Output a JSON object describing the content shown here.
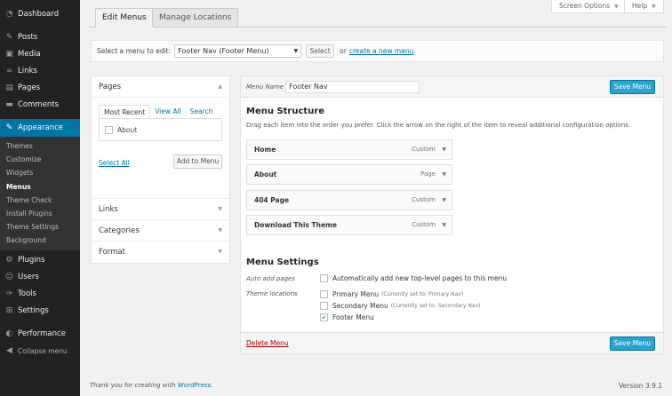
{
  "sidebar": {
    "items": [
      {
        "label": "Dashboard",
        "icon": "dashboard-icon",
        "glyph": "◔"
      },
      {
        "label": "Posts",
        "icon": "pin-icon",
        "glyph": "✎"
      },
      {
        "label": "Media",
        "icon": "media-icon",
        "glyph": "▣"
      },
      {
        "label": "Links",
        "icon": "link-icon",
        "glyph": "∞"
      },
      {
        "label": "Pages",
        "icon": "page-icon",
        "glyph": "▤"
      },
      {
        "label": "Comments",
        "icon": "comment-icon",
        "glyph": "▬"
      },
      {
        "label": "Appearance",
        "icon": "brush-icon",
        "glyph": "✎"
      },
      {
        "label": "Plugins",
        "icon": "plugin-icon",
        "glyph": "⚙"
      },
      {
        "label": "Users",
        "icon": "users-icon",
        "glyph": "☺"
      },
      {
        "label": "Tools",
        "icon": "wrench-icon",
        "glyph": "✑"
      },
      {
        "label": "Settings",
        "icon": "settings-icon",
        "glyph": "⊞"
      },
      {
        "label": "Performance",
        "icon": "performance-icon",
        "glyph": "◐"
      },
      {
        "label": "Collapse menu",
        "icon": "collapse-icon",
        "glyph": "◀"
      }
    ],
    "submenu": [
      "Themes",
      "Customize",
      "Widgets",
      "Menus",
      "Theme Check",
      "Install Plugins",
      "Theme Settings",
      "Background"
    ]
  },
  "tabs": {
    "edit_menus": "Edit Menus",
    "manage_locations": "Manage Locations"
  },
  "top_buttons": {
    "screen_options": "Screen Options",
    "help": "Help",
    "caret": "▼"
  },
  "select_bar": {
    "label": "Select a menu to edit:",
    "selected": "Footer Nav (Footer Menu)",
    "select_button": "Select",
    "or_text": "or",
    "create_link": "create a new menu",
    "period": "."
  },
  "left_panel": {
    "pages_title": "Pages",
    "tabs": [
      "Most Recent",
      "View All",
      "Search"
    ],
    "page_item": "About",
    "select_all": "Select All",
    "add_to_menu": "Add to Menu",
    "sections": [
      "Links",
      "Categories",
      "Format"
    ]
  },
  "menu_panel": {
    "name_label": "Menu Name",
    "name_value": "Footer Nav",
    "save_button": "Save Menu",
    "structure_title": "Menu Structure",
    "structure_hint": "Drag each item into the order you prefer. Click the arrow on the right of the item to reveal additional configuration options.",
    "items": [
      {
        "title": "Home",
        "type": "Custom"
      },
      {
        "title": "About",
        "type": "Page"
      },
      {
        "title": "404 Page",
        "type": "Custom"
      },
      {
        "title": "Download This Theme",
        "type": "Custom"
      }
    ],
    "settings_title": "Menu Settings",
    "auto_add_label": "Auto add pages",
    "auto_add_option": "Automatically add new top-level pages to this menu",
    "locations_label": "Theme locations",
    "locations": [
      {
        "name": "Primary Menu",
        "note": "(Currently set to: Primary Nav)",
        "checked": false
      },
      {
        "name": "Secondary Menu",
        "note": "(Currently set to: Secondary Nav)",
        "checked": false
      },
      {
        "name": "Footer Menu",
        "note": "",
        "checked": true
      }
    ],
    "delete_link": "Delete Menu"
  },
  "footer": {
    "thanks": "Thank you for creating with",
    "wp_link": "WordPress",
    "period": ".",
    "version": "Version 3.9.1"
  }
}
